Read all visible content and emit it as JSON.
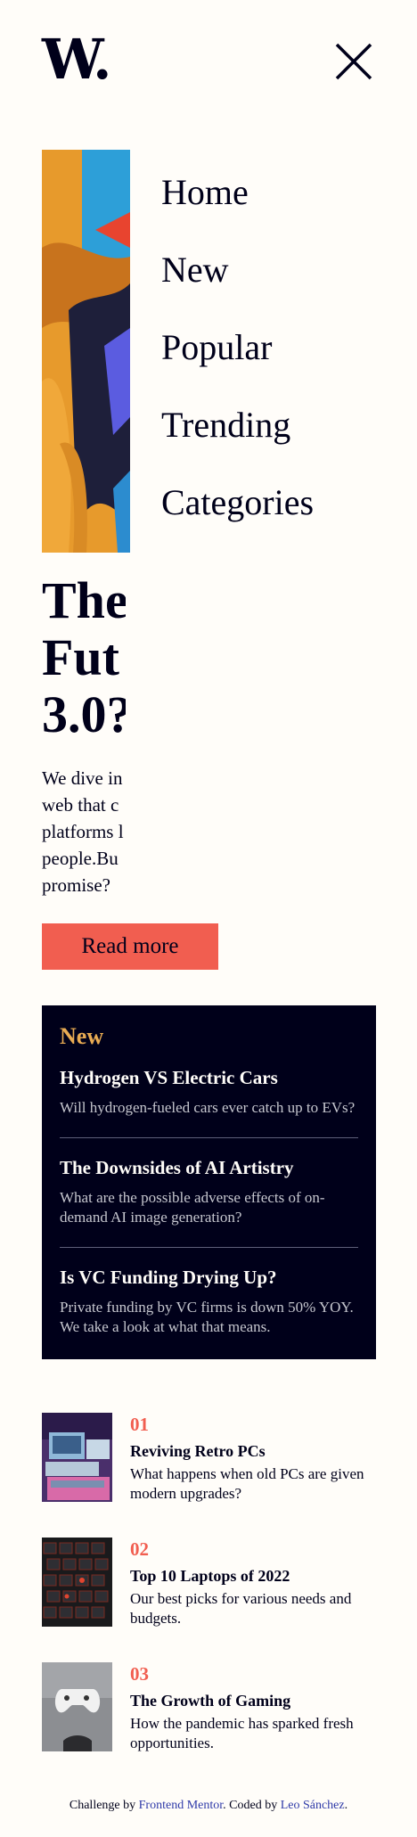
{
  "header": {
    "logo_text": "W.",
    "close_icon": "close-icon"
  },
  "nav": {
    "items": [
      "Home",
      "New",
      "Popular",
      "Trending",
      "Categories"
    ]
  },
  "hero": {
    "title_line1": "The",
    "title_line2": "Fut",
    "title_line3": "3.0?",
    "desc_lines": [
      "We dive in",
      "web that c",
      "platforms l",
      "people.Bu",
      "promise?"
    ],
    "read_more_label": "Read more"
  },
  "new_section": {
    "heading": "New",
    "items": [
      {
        "title": "Hydrogen VS Electric Cars",
        "desc": "Will hydrogen-fueled cars ever catch up to EVs?"
      },
      {
        "title": "The Downsides of AI Artistry",
        "desc": "What are the possible adverse effects of on-demand AI image generation?"
      },
      {
        "title": "Is VC Funding Drying Up?",
        "desc": "Private funding by VC firms is down 50% YOY. We take a look at what that means."
      }
    ]
  },
  "list": {
    "items": [
      {
        "number": "01",
        "title": "Reviving Retro PCs",
        "desc": "What happens when old PCs are given modern upgrades?"
      },
      {
        "number": "02",
        "title": "Top 10 Laptops of 2022",
        "desc": "Our best picks for various needs and budgets."
      },
      {
        "number": "03",
        "title": "The Growth of Gaming",
        "desc": "How the pandemic has sparked fresh opportunities."
      }
    ]
  },
  "footer": {
    "prefix": "Challenge by",
    "link1": "Frontend Mentor",
    "middle": ". Coded by",
    "link2": "Leo Sánchez",
    "suffix": "."
  },
  "colors": {
    "background": "#fffdf9",
    "dark": "#00001a",
    "accent_red": "#f15e50",
    "accent_orange": "#e9ab53"
  }
}
